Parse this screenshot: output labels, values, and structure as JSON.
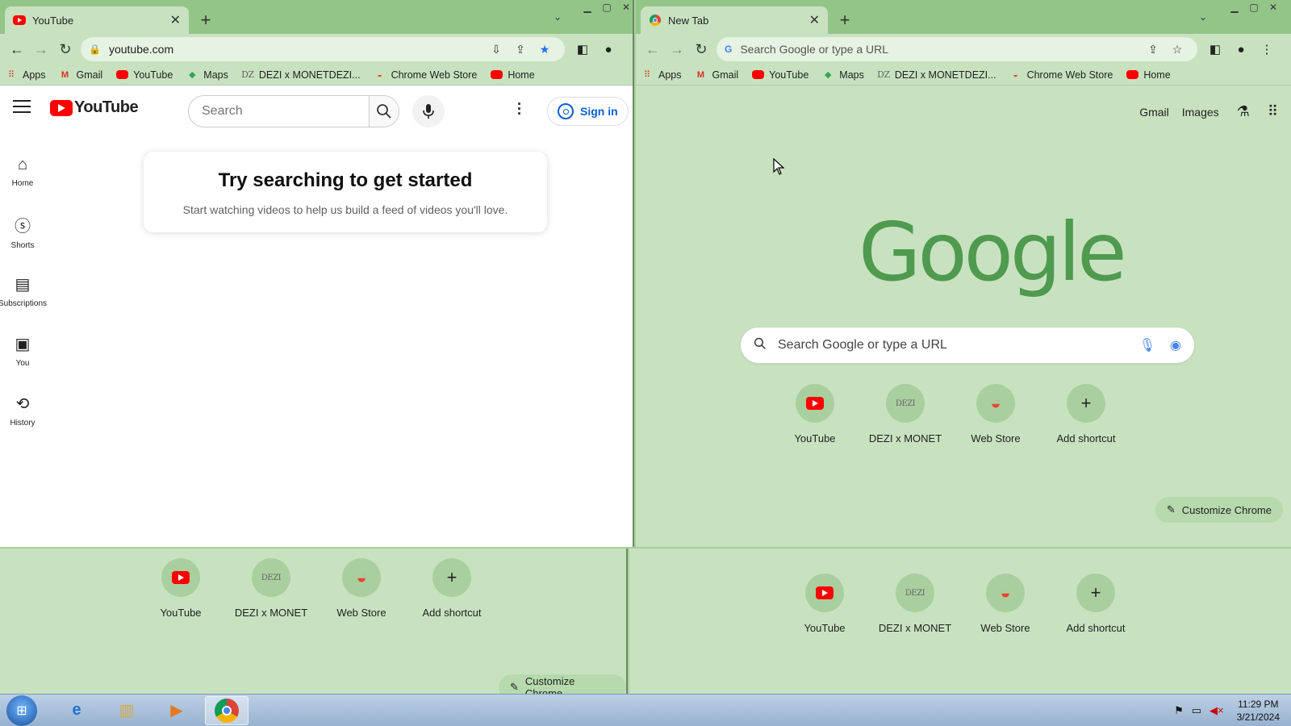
{
  "left_window": {
    "tab": {
      "title": "YouTube",
      "favicon": "youtube-icon"
    },
    "url": "youtube.com",
    "window_controls": [
      "minimize",
      "maximize",
      "close"
    ],
    "bookmarks": [
      {
        "label": "Apps",
        "icon": "apps-grid-icon"
      },
      {
        "label": "Gmail",
        "icon": "gmail-icon"
      },
      {
        "label": "YouTube",
        "icon": "youtube-icon"
      },
      {
        "label": "Maps",
        "icon": "maps-icon"
      },
      {
        "label": "DEZI x MONETDEZI...",
        "icon": "dezi-icon"
      },
      {
        "label": "Chrome Web Store",
        "icon": "webstore-icon"
      },
      {
        "label": "Home",
        "icon": "youtube-icon"
      }
    ],
    "page": {
      "logo_text": "YouTube",
      "search_placeholder": "Search",
      "sign_in": "Sign in",
      "sidebar": [
        {
          "label": "Home",
          "icon": "home-icon"
        },
        {
          "label": "Shorts",
          "icon": "shorts-icon"
        },
        {
          "label": "Subscriptions",
          "icon": "subscriptions-icon"
        },
        {
          "label": "You",
          "icon": "library-icon"
        },
        {
          "label": "History",
          "icon": "history-icon"
        }
      ],
      "card_title": "Try searching to get started",
      "card_subtitle": "Start watching videos to help us build a feed of videos you'll love."
    }
  },
  "right_window": {
    "tab": {
      "title": "New Tab",
      "favicon": "chrome-icon"
    },
    "omnibox_placeholder": "Search Google or type a URL",
    "bookmarks": [
      {
        "label": "Apps",
        "icon": "apps-grid-icon"
      },
      {
        "label": "Gmail",
        "icon": "gmail-icon"
      },
      {
        "label": "YouTube",
        "icon": "youtube-icon"
      },
      {
        "label": "Maps",
        "icon": "maps-icon"
      },
      {
        "label": "DEZI x MONETDEZI...",
        "icon": "dezi-icon"
      },
      {
        "label": "Chrome Web Store",
        "icon": "webstore-icon"
      },
      {
        "label": "Home",
        "icon": "youtube-icon"
      }
    ],
    "ntp": {
      "top_links": [
        "Gmail",
        "Images"
      ],
      "logo": "Google",
      "search_placeholder": "Search Google or type a URL",
      "customize": "Customize Chrome"
    }
  },
  "shortcuts": [
    {
      "label": "YouTube",
      "icon": "youtube-icon"
    },
    {
      "label": "DEZI x MONET",
      "icon": "dezi-icon",
      "glyph": "DEZI"
    },
    {
      "label": "Web Store",
      "icon": "webstore-icon"
    },
    {
      "label": "Add shortcut",
      "icon": "plus-icon"
    }
  ],
  "bottom_left": {
    "customize": "Customize Chrome"
  },
  "taskbar": {
    "clock_time": "11:29 PM",
    "clock_date": "3/21/2024"
  },
  "colors": {
    "theme_green": "#c8e2c0",
    "tabstrip_green": "#93c589",
    "youtube_red": "#ff0000",
    "signin_blue": "#065fd4"
  }
}
